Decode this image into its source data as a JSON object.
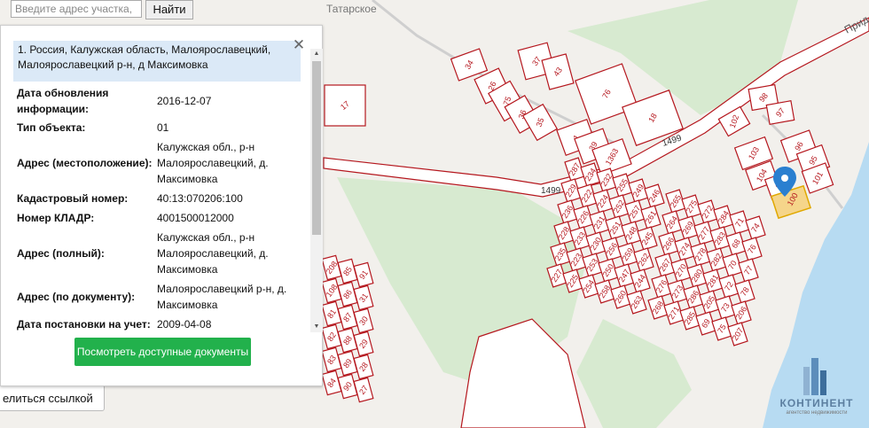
{
  "search": {
    "placeholder": "Введите адрес участка,",
    "button_label": "Найти"
  },
  "share": {
    "label": "елиться ссылкой"
  },
  "panel": {
    "header": "1. Россия, Калужская область, Малоярославецкий, Малоярославецкий р-н, д Максимовка",
    "rows": [
      {
        "label": "Дата обновления информации:",
        "value": "2016-12-07"
      },
      {
        "label": "Тип объекта:",
        "value": "01"
      },
      {
        "label": "Адрес (местоположение):",
        "value": "Калужская обл., р-н Малоярославецкий, д. Максимовка"
      },
      {
        "label": "Кадастровый номер:",
        "value": "40:13:070206:100"
      },
      {
        "label": "Номер КЛАДР:",
        "value": "4001500012000"
      },
      {
        "label": "Адрес (полный):",
        "value": "Калужская обл., р-н Малоярославецкий, д. Максимовка"
      },
      {
        "label": "Адрес (по документу):",
        "value": "Малоярославецкий р-н, д. Максимовка"
      },
      {
        "label": "Дата постановки на учет:",
        "value": "2009-04-08"
      }
    ],
    "docs_button": "Посмотреть доступные документы"
  },
  "map": {
    "places": {
      "village": "Татарское",
      "road_top": "Прид",
      "road_number": "1499"
    },
    "selected_parcel": "100",
    "parcels": [
      "34",
      "37",
      "43",
      "26",
      "75",
      "36",
      "35",
      "76",
      "18",
      "1",
      "39",
      "1363",
      "17",
      "98",
      "97",
      "102",
      "96",
      "95",
      "103",
      "104",
      "101",
      "9",
      "287",
      "229",
      "236",
      "228",
      "235",
      "227",
      "234",
      "222",
      "226",
      "233",
      "223",
      "225",
      "232",
      "224",
      "231",
      "230",
      "253",
      "254",
      "255",
      "252",
      "251",
      "256",
      "250",
      "258",
      "249",
      "257",
      "248",
      "259",
      "247",
      "260",
      "246",
      "261",
      "245",
      "262",
      "244",
      "263",
      "265",
      "264",
      "266",
      "267",
      "276",
      "268",
      "275",
      "269",
      "274",
      "270",
      "273",
      "271",
      "272",
      "277",
      "278",
      "280",
      "286",
      "285",
      "284",
      "283",
      "282",
      "281",
      "205",
      "69",
      "71",
      "68",
      "70",
      "72",
      "73",
      "75",
      "74",
      "76",
      "77",
      "78",
      "206",
      "207",
      "208",
      "108",
      "81",
      "82",
      "83",
      "84",
      "85",
      "86",
      "87",
      "88",
      "89",
      "90",
      "91",
      "31",
      "30",
      "29",
      "28",
      "27",
      "12"
    ],
    "colors": {
      "parcel_stroke": "#b5171e",
      "selected_fill": "#f5d58a",
      "forest": "#d7ead0",
      "water": "#b7dbf2",
      "road": "#ffffff"
    }
  },
  "logo": {
    "name": "КОНТИНЕНТ",
    "tagline": "агентство недвижимости"
  }
}
